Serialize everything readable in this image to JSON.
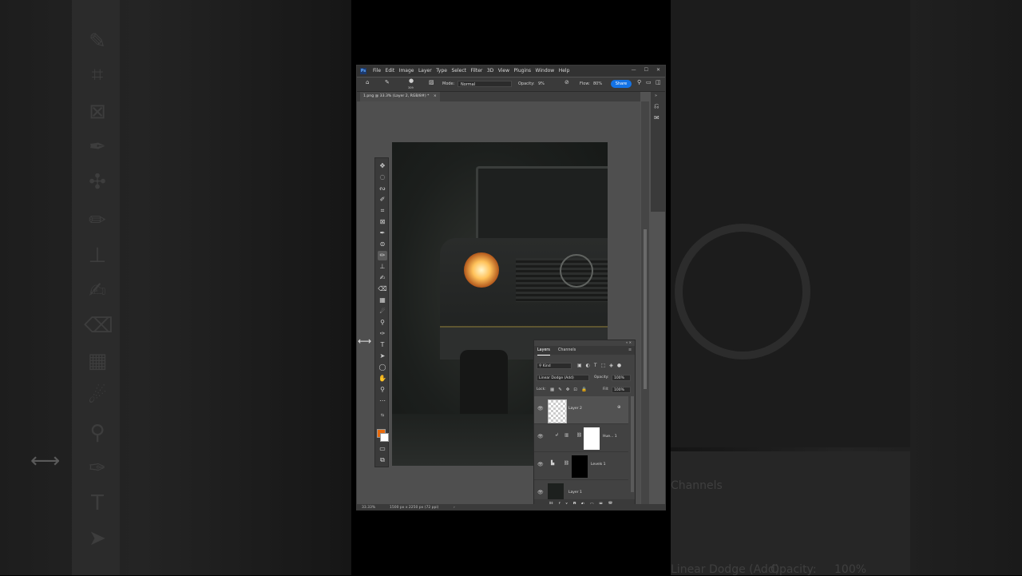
{
  "app": {
    "menu": [
      "File",
      "Edit",
      "Image",
      "Layer",
      "Type",
      "Select",
      "Filter",
      "3D",
      "View",
      "Plugins",
      "Window",
      "Help"
    ],
    "logo": "Ps",
    "window_controls": [
      "—",
      "☐",
      "✕"
    ]
  },
  "options_bar": {
    "brush_size": "309",
    "mode_label": "Mode:",
    "mode_value": "Normal",
    "opacity_label": "Opacity:",
    "opacity_value": "9%",
    "flow_label": "Flow:",
    "flow_value": "80%",
    "share_label": "Share"
  },
  "document": {
    "tab_title": "1.png @ 33.3% (Layer 2, RGB/8#) *"
  },
  "status_bar": {
    "zoom": "33.33%",
    "doc_info": "1500 px x 2250 px (72 ppi)"
  },
  "layers_panel": {
    "tabs": [
      "Layers",
      "Channels"
    ],
    "filter_kind": "Kind",
    "blend_mode": "Linear Dodge (Add)",
    "opacity_label": "Opacity:",
    "opacity_value": "100%",
    "lock_label": "Lock:",
    "fill_label": "Fill:",
    "fill_value": "100%",
    "layers": [
      {
        "name": "Layer 2"
      },
      {
        "name": "Hue... 1"
      },
      {
        "name": "Levels 1"
      },
      {
        "name": "Layer 1"
      }
    ]
  },
  "colors": {
    "foreground": "#e86b0e",
    "background": "#ffffff",
    "accent": "#1473e6"
  }
}
